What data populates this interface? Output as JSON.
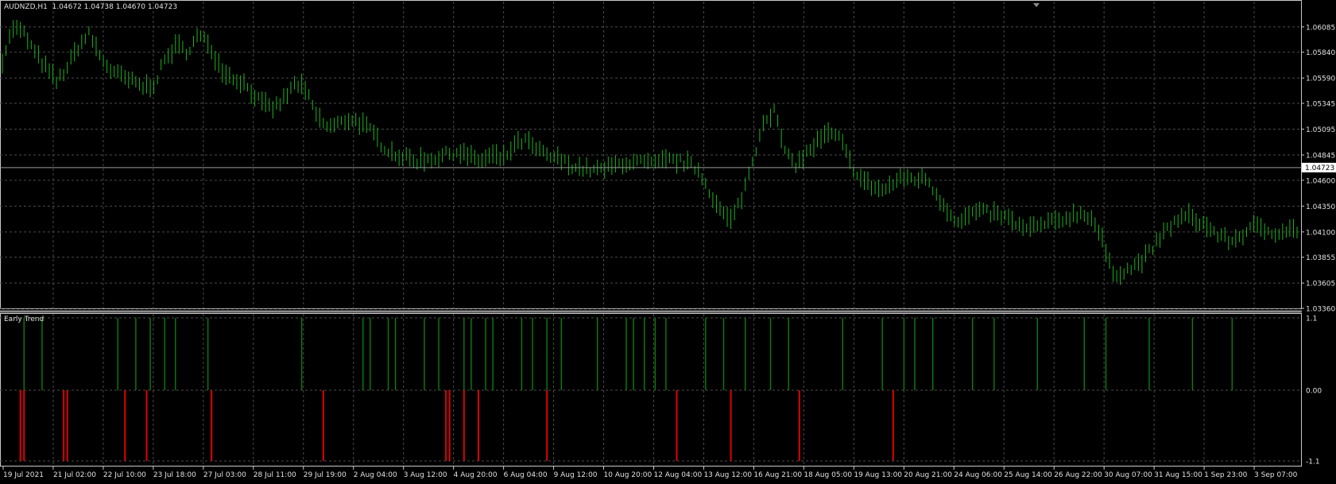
{
  "window": {
    "symbol_header": "AUDNZD,H1",
    "ohlc": "1.04672 1.04738 1.04670 1.04723"
  },
  "colors": {
    "background": "#000000",
    "grid": "#4a4a4a",
    "axis": "#c8c8c8",
    "price_bars": "#1db31d",
    "bull_bars": "#0d7d0d",
    "bear_bars": "#e00000"
  },
  "price_axis": {
    "labels": [
      "1.06085",
      "1.05840",
      "1.05590",
      "1.05345",
      "1.05095",
      "1.04845",
      "1.04600",
      "1.04350",
      "1.04100",
      "1.03855",
      "1.03605",
      "1.03360"
    ],
    "current_price": "1.04723"
  },
  "indicator": {
    "name": "Early Trend",
    "axis_labels": [
      "1.1",
      "0.00",
      "-1.1"
    ]
  },
  "time_axis": {
    "labels": [
      "19 Jul 2021",
      "21 Jul 02:00",
      "22 Jul 10:00",
      "23 Jul 18:00",
      "27 Jul 03:00",
      "28 Jul 11:00",
      "29 Jul 19:00",
      "2 Aug 04:00",
      "3 Aug 12:00",
      "4 Aug 20:00",
      "6 Aug 04:00",
      "9 Aug 12:00",
      "10 Aug 20:00",
      "12 Aug 04:00",
      "13 Aug 12:00",
      "16 Aug 21:00",
      "18 Aug 05:00",
      "19 Aug 13:00",
      "20 Aug 21:00",
      "24 Aug 06:00",
      "25 Aug 14:00",
      "26 Aug 22:00",
      "30 Aug 07:00",
      "31 Aug 15:00",
      "1 Sep 23:00",
      "3 Sep 07:00"
    ]
  },
  "chart_data": [
    {
      "type": "line",
      "title": "AUDNZD,H1",
      "x_ticks": [
        "19 Jul 2021",
        "21 Jul 02:00",
        "22 Jul 10:00",
        "23 Jul 18:00",
        "27 Jul 03:00",
        "28 Jul 11:00",
        "29 Jul 19:00",
        "2 Aug 04:00",
        "3 Aug 12:00",
        "4 Aug 20:00",
        "6 Aug 04:00",
        "9 Aug 12:00",
        "10 Aug 20:00",
        "12 Aug 04:00",
        "13 Aug 12:00",
        "16 Aug 21:00",
        "18 Aug 05:00",
        "19 Aug 13:00",
        "20 Aug 21:00",
        "24 Aug 06:00",
        "25 Aug 14:00",
        "26 Aug 22:00",
        "30 Aug 07:00",
        "31 Aug 15:00",
        "1 Sep 23:00",
        "3 Sep 07:00"
      ],
      "ylim": [
        1.0336,
        1.0633
      ],
      "close": [
        1.0577,
        1.0608,
        1.0602,
        1.0583,
        1.0569,
        1.0555,
        1.057,
        1.059,
        1.0602,
        1.058,
        1.0566,
        1.056,
        1.0555,
        1.055,
        1.0554,
        1.0578,
        1.059,
        1.0585,
        1.06,
        1.0592,
        1.057,
        1.056,
        1.0556,
        1.0545,
        1.0532,
        1.053,
        1.054,
        1.0555,
        1.0544,
        1.052,
        1.0511,
        1.0515,
        1.052,
        1.0515,
        1.0506,
        1.0493,
        1.0486,
        1.0482,
        1.0479,
        1.0481,
        1.0482,
        1.0486,
        1.0488,
        1.0482,
        1.0479,
        1.0484,
        1.048,
        1.0493,
        1.0499,
        1.049,
        1.0484,
        1.0481,
        1.0476,
        1.0472,
        1.047,
        1.047,
        1.0473,
        1.0477,
        1.0477,
        1.0477,
        1.0475,
        1.0479,
        1.0479,
        1.0476,
        1.047,
        1.045,
        1.043,
        1.042,
        1.0445,
        1.048,
        1.052,
        1.0527,
        1.0484,
        1.0475,
        1.0487,
        1.0498,
        1.0505,
        1.05,
        1.0475,
        1.046,
        1.0454,
        1.045,
        1.0458,
        1.0463,
        1.0461,
        1.0462,
        1.0444,
        1.043,
        1.0418,
        1.0428,
        1.0429,
        1.0428,
        1.0425,
        1.0419,
        1.0412,
        1.0415,
        1.0418,
        1.042,
        1.0425,
        1.0428,
        1.0426,
        1.0405,
        1.037,
        1.0372,
        1.0376,
        1.0385,
        1.0398,
        1.0412,
        1.0422,
        1.0425,
        1.042,
        1.0413,
        1.0405,
        1.0401,
        1.0408,
        1.0415,
        1.0412,
        1.041,
        1.0412,
        1.0412
      ]
    },
    {
      "type": "bar",
      "title": "Early Trend",
      "ylim": [
        -1.1,
        1.1
      ],
      "bull_signal_index": [
        6,
        11,
        32,
        37,
        41,
        45,
        48,
        57,
        83,
        100,
        102,
        107,
        109,
        117,
        121,
        128,
        130,
        134,
        136,
        144,
        147,
        151,
        155,
        165,
        173,
        175,
        178,
        181,
        184,
        195,
        200,
        206,
        213,
        218,
        233,
        244,
        250,
        253,
        258,
        269,
        275,
        287,
        300,
        306,
        318,
        330,
        341
      ],
      "bear_signal_index": [
        5,
        6,
        17,
        18,
        34,
        40,
        58,
        89,
        123,
        124,
        128,
        132,
        151,
        187,
        202,
        221,
        247
      ]
    }
  ]
}
